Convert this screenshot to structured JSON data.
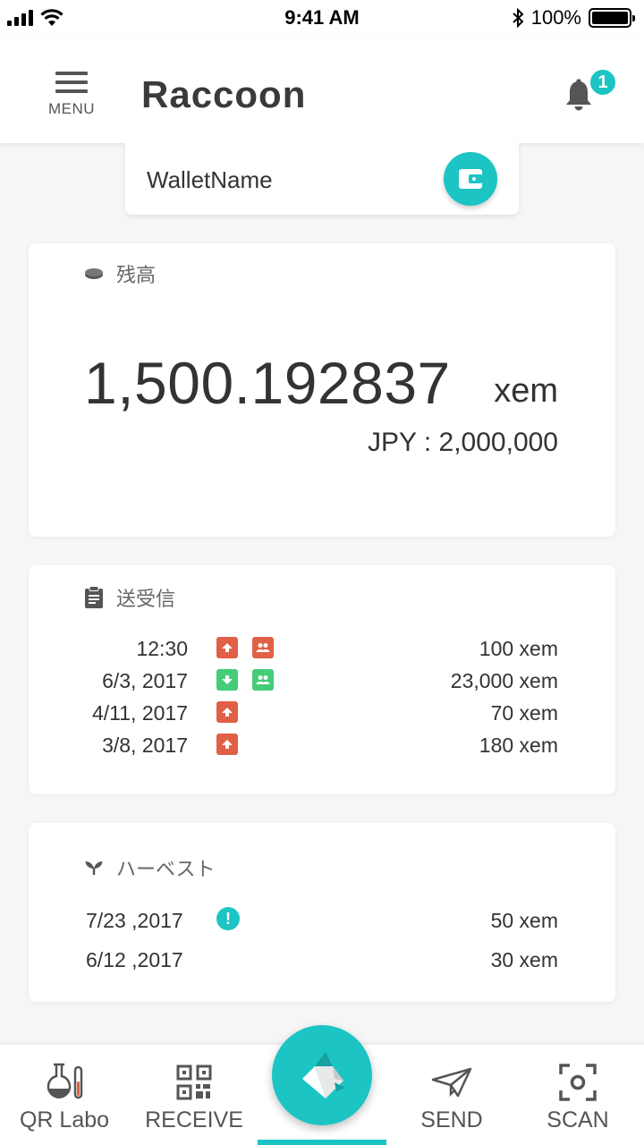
{
  "status_bar": {
    "time": "9:41 AM",
    "battery": "100%",
    "battery_level": 1.0
  },
  "header": {
    "menu_label": "MENU",
    "app_title": "Raccoon",
    "notification_count": "1"
  },
  "wallet": {
    "name": "WalletName"
  },
  "balance": {
    "title": "残高",
    "amount": "1,500.192837",
    "unit": "xem",
    "jpy": "JPY : 2,000,000"
  },
  "transactions": {
    "title": "送受信",
    "rows": [
      {
        "date": "12:30",
        "direction": "outgoing",
        "multisig": true,
        "amount": "100 xem"
      },
      {
        "date": "6/3, 2017",
        "direction": "incoming",
        "multisig": true,
        "amount": "23,000 xem"
      },
      {
        "date": "4/11, 2017",
        "direction": "outgoing",
        "multisig": false,
        "amount": "70 xem"
      },
      {
        "date": "3/8, 2017",
        "direction": "outgoing",
        "multisig": false,
        "amount": "180 xem"
      }
    ]
  },
  "harvest": {
    "title": "ハーベスト",
    "rows": [
      {
        "date": "7/23 ,2017",
        "alert": true,
        "amount": "50 xem"
      },
      {
        "date": "6/12 ,2017",
        "alert": false,
        "amount": "30 xem"
      }
    ]
  },
  "bottom_nav": {
    "qr_labo": "QR Labo",
    "receive": "RECEIVE",
    "send": "SEND",
    "scan": "SCAN"
  },
  "colors": {
    "accent": "#1cc4c4",
    "outgoing": "#e06045",
    "incoming": "#44cc77"
  }
}
